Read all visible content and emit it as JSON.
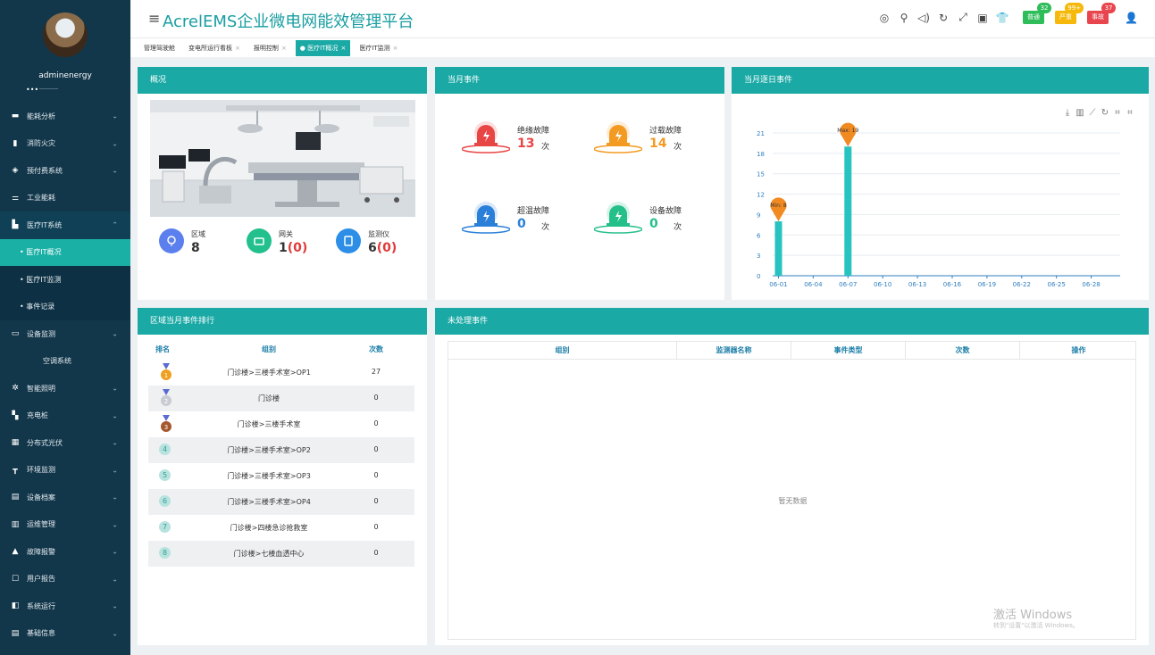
{
  "app": {
    "title": "AcrelEMS企业微电网能效管理平台",
    "user": "adminenergy",
    "brand_color": "#1aa9a5"
  },
  "sidebar": {
    "items": [
      {
        "label": "能耗分析",
        "icon": "monitor-icon",
        "chevron": "⌄"
      },
      {
        "label": "消防火灾",
        "icon": "fire-extinguisher-icon",
        "chevron": "⌄"
      },
      {
        "label": "预付费系统",
        "icon": "prepaid-icon",
        "chevron": "⌄"
      },
      {
        "label": "工业能耗",
        "icon": "factory-icon",
        "chevron": ""
      },
      {
        "label": "医疗IT系统",
        "icon": "medical-icon",
        "chevron": "⌃"
      },
      {
        "label": "• 医疗IT概况",
        "sub": true,
        "current": true
      },
      {
        "label": "• 医疗IT监测",
        "sub": true
      },
      {
        "label": "• 事件记录",
        "sub": true
      },
      {
        "label": "设备监测",
        "icon": "device-icon",
        "chevron": "⌄"
      },
      {
        "label": "空调系统",
        "plain": true
      },
      {
        "label": "智能照明",
        "icon": "light-icon",
        "chevron": "⌄"
      },
      {
        "label": "充电桩",
        "icon": "charger-icon",
        "chevron": "⌄"
      },
      {
        "label": "分布式光伏",
        "icon": "solar-icon",
        "chevron": "⌄"
      },
      {
        "label": "环境监测",
        "icon": "environment-icon",
        "chevron": "⌄"
      },
      {
        "label": "设备档案",
        "icon": "archive-icon",
        "chevron": "⌄"
      },
      {
        "label": "运维管理",
        "icon": "maintenance-icon",
        "chevron": "⌄"
      },
      {
        "label": "故障报警",
        "icon": "alarm-icon",
        "chevron": "⌄"
      },
      {
        "label": "用户报告",
        "icon": "report-icon",
        "chevron": "⌄"
      },
      {
        "label": "系统运行",
        "icon": "system-icon",
        "chevron": "⌄"
      },
      {
        "label": "基础信息",
        "icon": "info-icon",
        "chevron": "⌄"
      }
    ]
  },
  "header": {
    "badges": [
      {
        "label": "普通",
        "count": "32",
        "color": "#2ebd59",
        "count_color": "#2ebd59"
      },
      {
        "label": "严重",
        "count": "99+",
        "color": "#f5b80b",
        "count_color": "#f5b80b"
      },
      {
        "label": "事故",
        "count": "37",
        "color": "#e8454f",
        "count_color": "#e8454f"
      }
    ]
  },
  "tabs": [
    {
      "label": "管理驾驶舱",
      "close": ""
    },
    {
      "label": "变电所运行看板",
      "close": "×"
    },
    {
      "label": "报明控制",
      "close": "×"
    },
    {
      "label": "● 医疗IT概况",
      "close": "×",
      "active": true
    },
    {
      "label": "医疗IT监测",
      "close": "×"
    }
  ],
  "overview": {
    "title": "概况",
    "stats": [
      {
        "label": "区域",
        "value": "8",
        "extra": ""
      },
      {
        "label": "网关",
        "value": "1",
        "extra": "(0)"
      },
      {
        "label": "监测仪",
        "value": "6",
        "extra": "(0)"
      }
    ]
  },
  "month_events": {
    "title": "当月事件",
    "items": [
      {
        "label": "绝缘故障",
        "value": "13",
        "unit": "次",
        "color": "#e84545"
      },
      {
        "label": "过载故障",
        "value": "14",
        "unit": "次",
        "color": "#f39a22"
      },
      {
        "label": "超温故障",
        "value": "0",
        "unit": "次",
        "color": "#2a7fd9"
      },
      {
        "label": "设备故障",
        "value": "0",
        "unit": "次",
        "color": "#25c08a"
      }
    ]
  },
  "daily": {
    "title": "当月逐日事件"
  },
  "chart_data": {
    "type": "bar",
    "x": [
      "06-01",
      "06-02",
      "06-03",
      "06-04",
      "06-05",
      "06-06",
      "06-07",
      "06-08",
      "06-09",
      "06-10",
      "06-11",
      "06-12",
      "06-13",
      "06-14",
      "06-15",
      "06-16",
      "06-17",
      "06-18",
      "06-19",
      "06-20",
      "06-21",
      "06-22",
      "06-23",
      "06-24",
      "06-25",
      "06-26",
      "06-27",
      "06-28",
      "06-29",
      "06-30"
    ],
    "xticks": [
      "06-01",
      "06-04",
      "06-07",
      "06-10",
      "06-13",
      "06-16",
      "06-19",
      "06-22",
      "06-25",
      "06-28"
    ],
    "values": [
      8,
      0,
      0,
      0,
      0,
      0,
      19,
      0,
      0,
      0,
      0,
      0,
      0,
      0,
      0,
      0,
      0,
      0,
      0,
      0,
      0,
      0,
      0,
      0,
      0,
      0,
      0,
      0,
      0,
      0
    ],
    "ylim": [
      0,
      21
    ],
    "yticks": [
      0,
      3,
      6,
      9,
      12,
      15,
      18,
      21
    ],
    "markers": [
      {
        "label": "Min: 8",
        "x": "06-01",
        "value": 8
      },
      {
        "label": "Max: 19",
        "x": "06-07",
        "value": 19
      }
    ],
    "colors": {
      "bar": "#26c3c0",
      "marker": "#f28a22",
      "axis": "#2f7fc0"
    }
  },
  "ranking": {
    "title": "区域当月事件排行",
    "headers": [
      "排名",
      "组别",
      "次数"
    ],
    "rows": [
      {
        "rank": "1",
        "medal": "gold",
        "group": "门诊楼>三楼手术室>OP1",
        "count": "27"
      },
      {
        "rank": "2",
        "medal": "silver",
        "group": "门诊楼",
        "count": "0"
      },
      {
        "rank": "3",
        "medal": "bronze",
        "group": "门诊楼>三楼手术室",
        "count": "0"
      },
      {
        "rank": "4",
        "group": "门诊楼>三楼手术室>OP2",
        "count": "0"
      },
      {
        "rank": "5",
        "group": "门诊楼>三楼手术室>OP3",
        "count": "0"
      },
      {
        "rank": "6",
        "group": "门诊楼>三楼手术室>OP4",
        "count": "0"
      },
      {
        "rank": "7",
        "group": "门诊楼>四楼急诊抢救室",
        "count": "0"
      },
      {
        "rank": "8",
        "group": "门诊楼>七楼血透中心",
        "count": "0"
      }
    ]
  },
  "unprocessed": {
    "title": "未处理事件",
    "columns": [
      "组别",
      "监测器名称",
      "事件类型",
      "次数",
      "操作"
    ],
    "empty": "暂无数据"
  },
  "watermark": {
    "line1": "激活 Windows",
    "line2": "转到\"设置\"以激活 Windows。"
  }
}
